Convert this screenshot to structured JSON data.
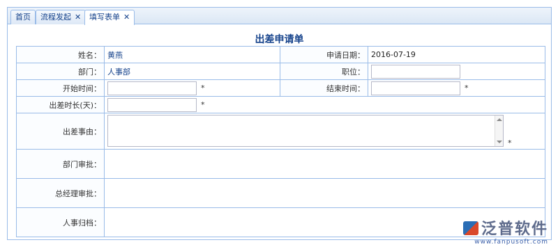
{
  "tabs": [
    {
      "label": "首页",
      "closable": false
    },
    {
      "label": "流程发起",
      "closable": true
    },
    {
      "label": "填写表单",
      "closable": true,
      "active": true
    }
  ],
  "close_glyph": "✕",
  "form": {
    "title": "出差申请单",
    "name_label": "姓名：",
    "name_value": "黄燕",
    "apply_date_label": "申请日期：",
    "apply_date_value": "2016-07-19",
    "dept_label": "部门：",
    "dept_value": "人事部",
    "position_label": "职位：",
    "position_value": "",
    "start_label": "开始时间：",
    "start_value": "",
    "end_label": "结束时间：",
    "end_value": "",
    "duration_label": "出差时长(天)：",
    "duration_value": "",
    "reason_label": "出差事由：",
    "reason_value": "",
    "dept_approval_label": "部门审批：",
    "gm_approval_label": "总经理审批：",
    "hr_archive_label": "人事归档：",
    "required_mark": "*"
  },
  "watermark": {
    "brand": "泛普软件",
    "url": "www.fanpusoft.com"
  },
  "colors": {
    "border": "#99bbe8",
    "accent": "#15428b",
    "tab_bg": "#dbe7f5"
  }
}
